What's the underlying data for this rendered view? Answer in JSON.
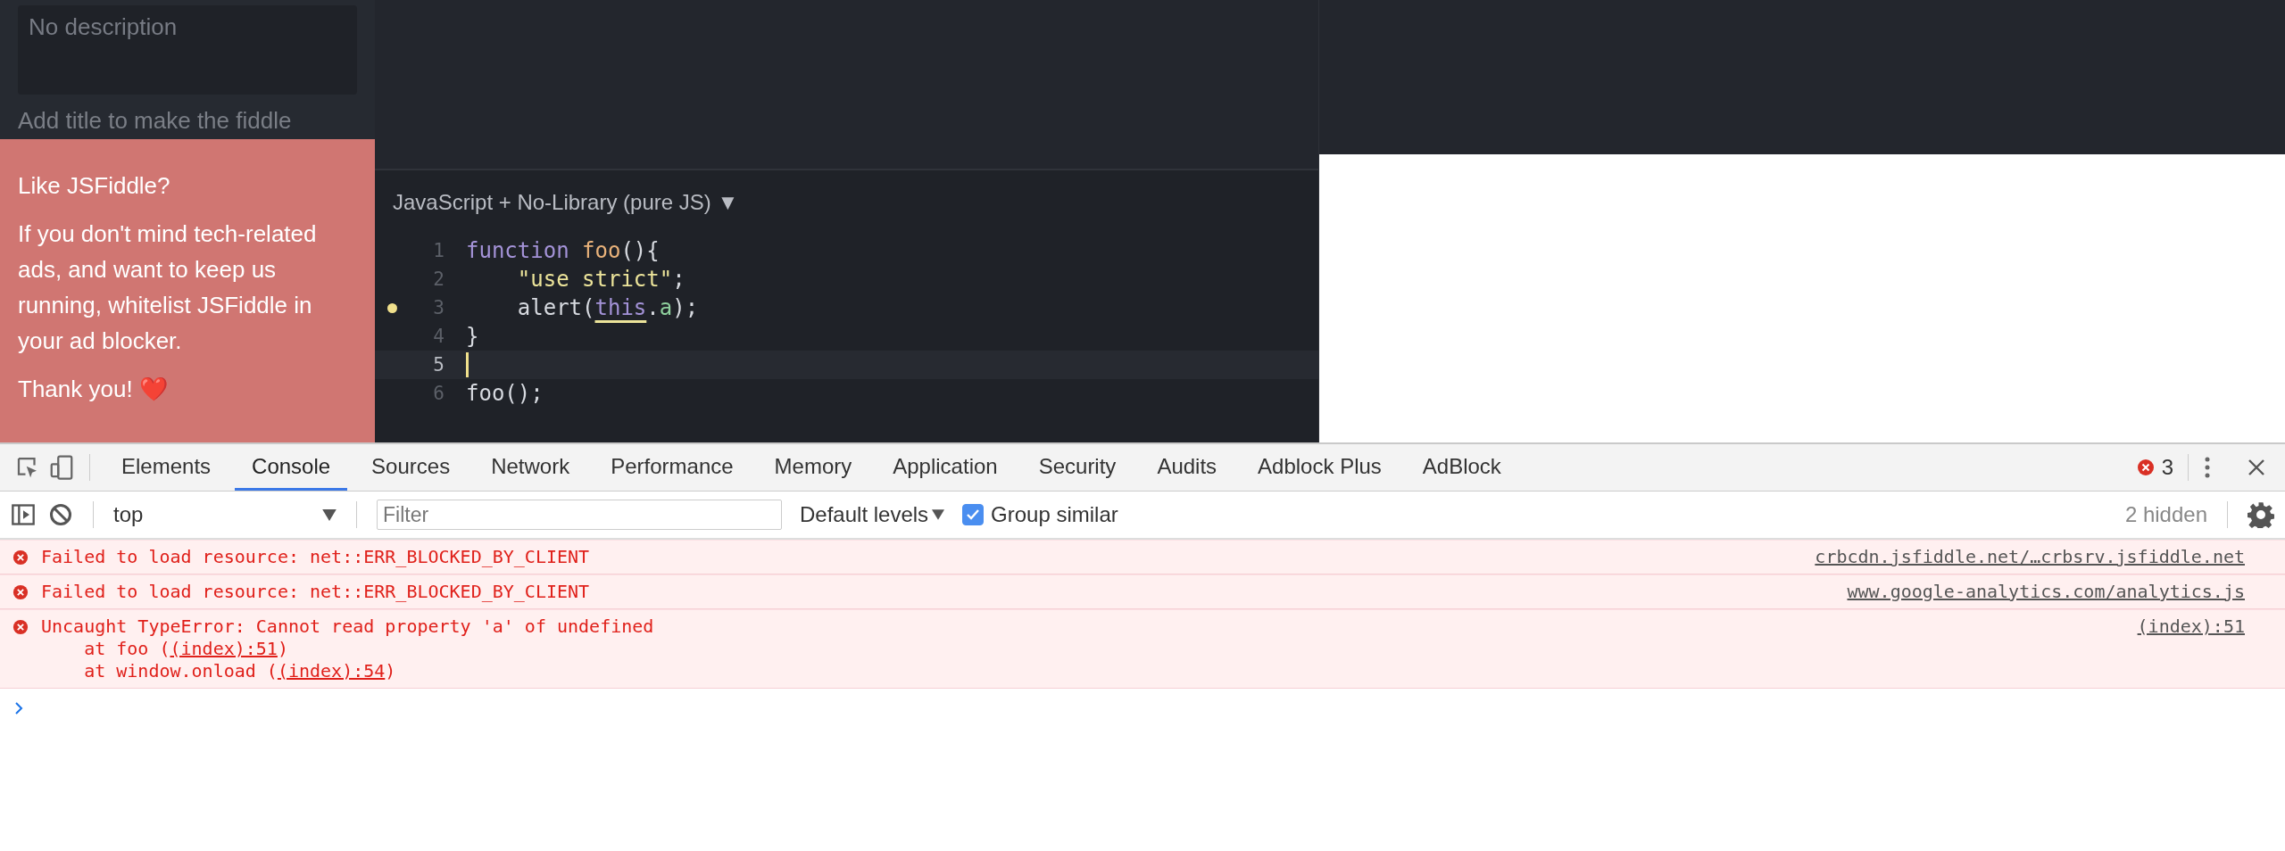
{
  "sidebar": {
    "description": {
      "placeholder": "No description"
    },
    "hint": "Add title to make the fiddle"
  },
  "ad": {
    "title": "Like JSFiddle?",
    "body": "If you don't mind tech-related ads, and want to keep us running, whitelist JSFiddle in your ad blocker.",
    "thanks": "Thank you! ❤️"
  },
  "editor": {
    "language": "JavaScript + No-Library (pure JS)",
    "language_caret": "▼",
    "lines": [
      {
        "number": "1",
        "marker": false,
        "active": false,
        "indent": false,
        "tokens": [
          {
            "kind": "keyword",
            "text": "function "
          },
          {
            "kind": "name",
            "text": "foo"
          },
          {
            "kind": "plain",
            "text": "(){"
          }
        ]
      },
      {
        "number": "2",
        "marker": false,
        "active": false,
        "indent": true,
        "tokens": [
          {
            "kind": "string",
            "text": "\"use strict\""
          },
          {
            "kind": "plain",
            "text": ";"
          }
        ]
      },
      {
        "number": "3",
        "marker": true,
        "active": false,
        "indent": true,
        "tokens": [
          {
            "kind": "plain",
            "text": "alert("
          },
          {
            "kind": "this",
            "text": "this"
          },
          {
            "kind": "plain",
            "text": "."
          },
          {
            "kind": "property",
            "text": "a"
          },
          {
            "kind": "plain",
            "text": ");"
          }
        ]
      },
      {
        "number": "4",
        "marker": false,
        "active": false,
        "indent": false,
        "tokens": [
          {
            "kind": "plain",
            "text": "}"
          }
        ]
      },
      {
        "number": "5",
        "marker": false,
        "active": true,
        "indent": false
      },
      {
        "number": "6",
        "marker": false,
        "active": false,
        "indent": false,
        "tokens": [
          {
            "kind": "plain",
            "text": "foo();"
          }
        ]
      }
    ]
  },
  "devtools": {
    "tabs": [
      {
        "label": "Elements",
        "selected": false
      },
      {
        "label": "Console",
        "selected": true
      },
      {
        "label": "Sources",
        "selected": false
      },
      {
        "label": "Network",
        "selected": false
      },
      {
        "label": "Performance",
        "selected": false
      },
      {
        "label": "Memory",
        "selected": false
      },
      {
        "label": "Application",
        "selected": false
      },
      {
        "label": "Security",
        "selected": false
      },
      {
        "label": "Audits",
        "selected": false
      },
      {
        "label": "Adblock Plus",
        "selected": false
      },
      {
        "label": "AdBlock",
        "selected": false
      }
    ],
    "error_count": "3",
    "console_toolbar": {
      "context": "top",
      "filter_placeholder": "Filter",
      "levels": "Default levels",
      "group_similar": {
        "label": "Group similar",
        "checked": true
      },
      "hidden": "2 hidden"
    },
    "messages": [
      {
        "text": "Failed to load resource: net::ERR_BLOCKED_BY_CLIENT",
        "source": "crbcdn.jsfiddle.net/…crbsrv.jsfiddle.net"
      },
      {
        "text": "Failed to load resource: net::ERR_BLOCKED_BY_CLIENT",
        "source": "www.google-analytics.com/analytics.js"
      },
      {
        "text": "Uncaught TypeError: Cannot read property 'a' of undefined",
        "source": "(index):51",
        "stack": [
          {
            "prefix": "at foo (",
            "link": "(index):51",
            "suffix": ")"
          },
          {
            "prefix": "at window.onload (",
            "link": "(index):54",
            "suffix": ")"
          }
        ]
      }
    ]
  }
}
